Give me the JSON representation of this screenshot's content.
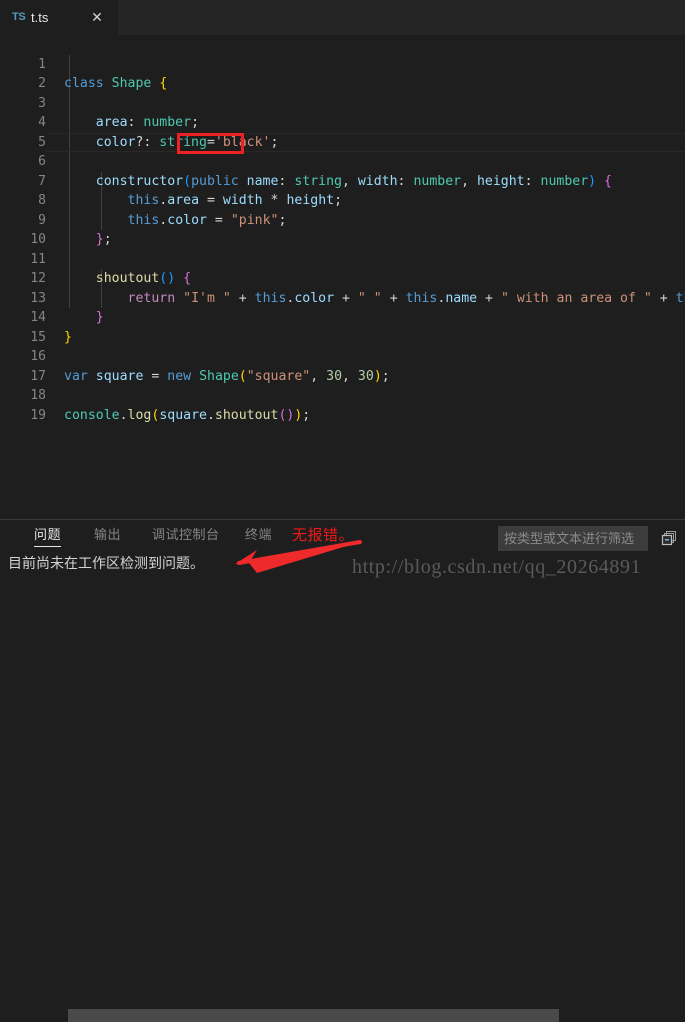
{
  "window": {
    "background": "#1e1e1e",
    "tabbar_background": "#252526"
  },
  "tabbar": {
    "tabs": [
      {
        "file_type": "TS",
        "label": "t.ts",
        "close_label": "✕",
        "active": true
      }
    ]
  },
  "editor": {
    "language": "typescript",
    "first_line": 1,
    "line_numbers": [
      "1",
      "2",
      "3",
      "4",
      "5",
      "6",
      "7",
      "8",
      "9",
      "10",
      "11",
      "12",
      "13",
      "14",
      "15",
      "16",
      "17",
      "18",
      "19"
    ],
    "lines": [
      "class Shape {",
      "",
      "    area: number;",
      "    color?: string='black';",
      "",
      "    constructor(public name: string, width: number, height: number) {",
      "        this.area = width * height;",
      "        this.color = \"pink\";",
      "    };",
      "",
      "    shoutout() {",
      "        return \"I'm \" + this.color + \" \" + this.name + \" with an area of \" + this",
      "    }",
      "}",
      "",
      "var square = new Shape(\"square\", 30, 30);",
      "",
      "console.log(square.shoutout());",
      ""
    ],
    "cursor_line": 6,
    "highlight": {
      "token": "public",
      "line": 6,
      "box_color": "#ee2222"
    },
    "colors": {
      "keyword": "#569cd6",
      "type": "#4ec9b0",
      "string": "#ce9178",
      "number": "#b5cea8",
      "function": "#dcdcaa",
      "property": "#9cdcfe",
      "control": "#c586c0",
      "punctuation": "#d4d4d4",
      "line_number": "#858585"
    }
  },
  "scrollbar": {
    "orientation": "horizontal",
    "thumb_color": "#4a4a4a"
  },
  "panel": {
    "tabs": [
      {
        "label": "问题",
        "active": true
      },
      {
        "label": "输出",
        "active": false
      },
      {
        "label": "调试控制台",
        "active": false
      },
      {
        "label": "终端",
        "active": false
      }
    ],
    "message": "目前尚未在工作区检测到问题。",
    "filter": {
      "placeholder": "按类型或文本进行筛选",
      "value": ""
    },
    "collapse_button_title": "折叠全部"
  },
  "annotations": {
    "note_text": "无报错。",
    "note_color": "#f01818",
    "arrow_color": "#ee2a2a"
  },
  "watermark": {
    "text": "http://blog.csdn.net/qq_20264891",
    "color": "#5a5a5a"
  }
}
